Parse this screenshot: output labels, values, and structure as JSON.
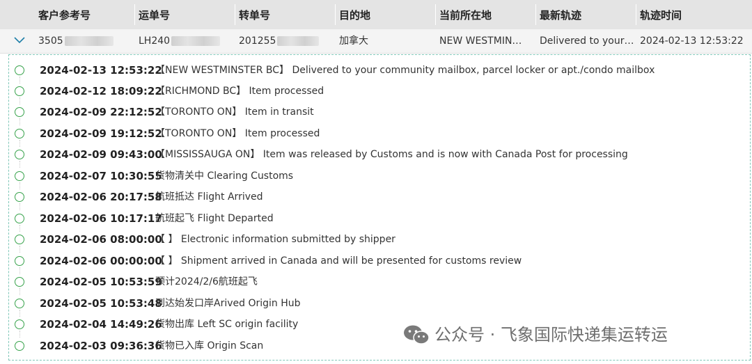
{
  "columns": [
    "客户参考号",
    "运单号",
    "转单号",
    "目的地",
    "当前所在地",
    "最新轨迹",
    "轨迹时间"
  ],
  "row": {
    "customer_ref": "3505",
    "waybill_no": "LH240",
    "transfer_no": "201255",
    "destination": "加拿大",
    "current_location": "NEW WESTMIN…",
    "latest_track": "Delivered to your…",
    "track_time": "2024-02-13 12:53:22"
  },
  "events": [
    {
      "time": "2024-02-13 12:53:22",
      "desc": "【NEW WESTMINSTER BC】 Delivered to your community mailbox, parcel locker or apt./condo mailbox"
    },
    {
      "time": "2024-02-12 18:09:22",
      "desc": "【RICHMOND BC】 Item processed"
    },
    {
      "time": "2024-02-09 22:12:52",
      "desc": "【TORONTO ON】 Item in transit"
    },
    {
      "time": "2024-02-09 19:12:52",
      "desc": "【TORONTO ON】 Item processed"
    },
    {
      "time": "2024-02-09 09:43:00",
      "desc": "【MISSISSAUGA ON】 Item was released by Customs and is now with Canada Post for processing"
    },
    {
      "time": "2024-02-07 10:30:55",
      "desc": "货物清关中 Clearing Customs"
    },
    {
      "time": "2024-02-06 20:17:58",
      "desc": "航班抵达 Flight Arrived"
    },
    {
      "time": "2024-02-06 10:17:17",
      "desc": "航班起飞 Flight Departed"
    },
    {
      "time": "2024-02-06 08:00:00",
      "desc": "【 】 Electronic information submitted by shipper"
    },
    {
      "time": "2024-02-06 00:00:00",
      "desc": "【 】 Shipment arrived in Canada and will be presented for customs review"
    },
    {
      "time": "2024-02-05 10:53:59",
      "desc": "预计2024/2/6航班起飞"
    },
    {
      "time": "2024-02-05 10:53:48",
      "desc": "到达始发口岸Arived Origin Hub"
    },
    {
      "time": "2024-02-04 14:49:26",
      "desc": "货物出库 Left SC origin facility"
    },
    {
      "time": "2024-02-03 09:36:36",
      "desc": "货物已入库 Origin Scan"
    }
  ],
  "watermark": {
    "text": "公众号 · 飞象国际快递集运转运",
    "icon": "wechat-icon"
  },
  "colors": {
    "header_bg": "#e4e4e4",
    "row_bg": "#f4f4f4",
    "dot": "#37a24b",
    "panel_border": "#7fc7b8"
  }
}
